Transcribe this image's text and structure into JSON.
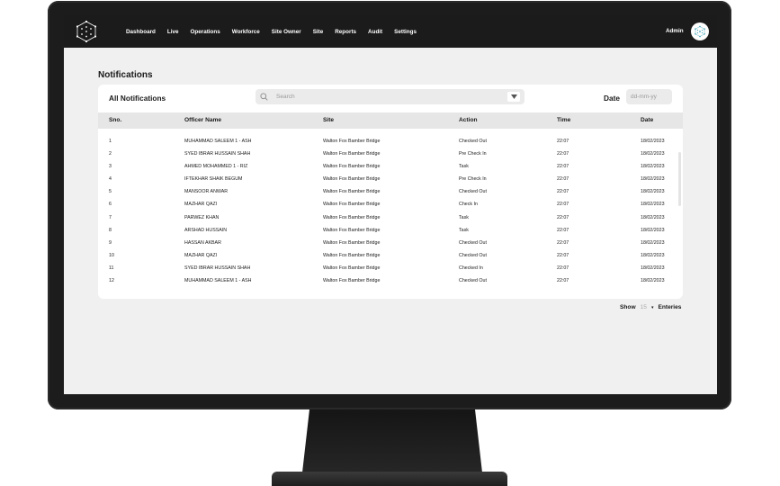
{
  "nav": {
    "items": [
      "Dashboard",
      "Live",
      "Operations",
      "Workforce",
      "Site Owner",
      "Site",
      "Reports",
      "Audit",
      "Settings"
    ],
    "user": "Admin"
  },
  "page": {
    "title": "Notifications"
  },
  "card": {
    "title": "All Notifications",
    "search": {
      "placeholder": "Search"
    },
    "date": {
      "label": "Date",
      "placeholder": "dd-mm-yy"
    }
  },
  "table": {
    "headers": [
      "Sno.",
      "Officer Name",
      "Site",
      "Action",
      "Time",
      "Date"
    ],
    "rows": [
      [
        "1",
        "MUHAMMAD SALEEM 1 - ASH",
        "Walton Fox Bamber Bridge",
        "Checked Out",
        "22:07",
        "18/02/2023"
      ],
      [
        "2",
        "SYED IBRAR HUSSAIN SHAH",
        "Walton Fox Bamber Bridge",
        "Pre Check In",
        "22:07",
        "18/02/2023"
      ],
      [
        "3",
        "AHMED MOHAMMED 1 - RIZ",
        "Walton Fox Bamber Bridge",
        "Task",
        "22:07",
        "18/02/2023"
      ],
      [
        "4",
        "IFTEKHAR SHAIK BEGUM",
        "Walton Fox Bamber Bridge",
        "Pre Check In",
        "22:07",
        "18/02/2023"
      ],
      [
        "5",
        "MANSOOR ANWAR",
        "Walton Fox Bamber Bridge",
        "Checked Out",
        "22:07",
        "18/02/2023"
      ],
      [
        "6",
        "MAZHAR QAZI",
        "Walton Fox Bamber Bridge",
        "Check In",
        "22:07",
        "18/02/2023"
      ],
      [
        "7",
        "PARWEZ KHAN",
        "Walton Fox Bamber Bridge",
        "Task",
        "22:07",
        "18/02/2023"
      ],
      [
        "8",
        "ARSHAD HUSSAIN",
        "Walton Fox Bamber Bridge",
        "Task",
        "22:07",
        "18/02/2023"
      ],
      [
        "9",
        "HASSAN AKBAR",
        "Walton Fox Bamber Bridge",
        "Checked Out",
        "22:07",
        "18/02/2023"
      ],
      [
        "10",
        "MAZHAR QAZI",
        "Walton Fox Bamber Bridge",
        "Checked Out",
        "22:07",
        "18/02/2023"
      ],
      [
        "11",
        "SYED IBRAR HUSSAIN SHAH",
        "Walton Fox Bamber Bridge",
        "Checked In",
        "22:07",
        "18/02/2023"
      ],
      [
        "12",
        "MUHAMMAD SALEEM 1 - ASH",
        "Walton Fox Bamber Bridge",
        "Checked Out",
        "22:07",
        "18/02/2023"
      ]
    ]
  },
  "footer": {
    "show_label": "Show",
    "count": "15",
    "entries_label": "Enteries"
  },
  "colors": {
    "topbar": "#1b1b1b",
    "page_bg": "#f0f0f0",
    "card_bg": "#ffffff",
    "table_header_bg": "#e6e6e6"
  },
  "icons": [
    "logo-icon",
    "avatar-logo-icon",
    "search-icon",
    "chevron-down-icon"
  ]
}
